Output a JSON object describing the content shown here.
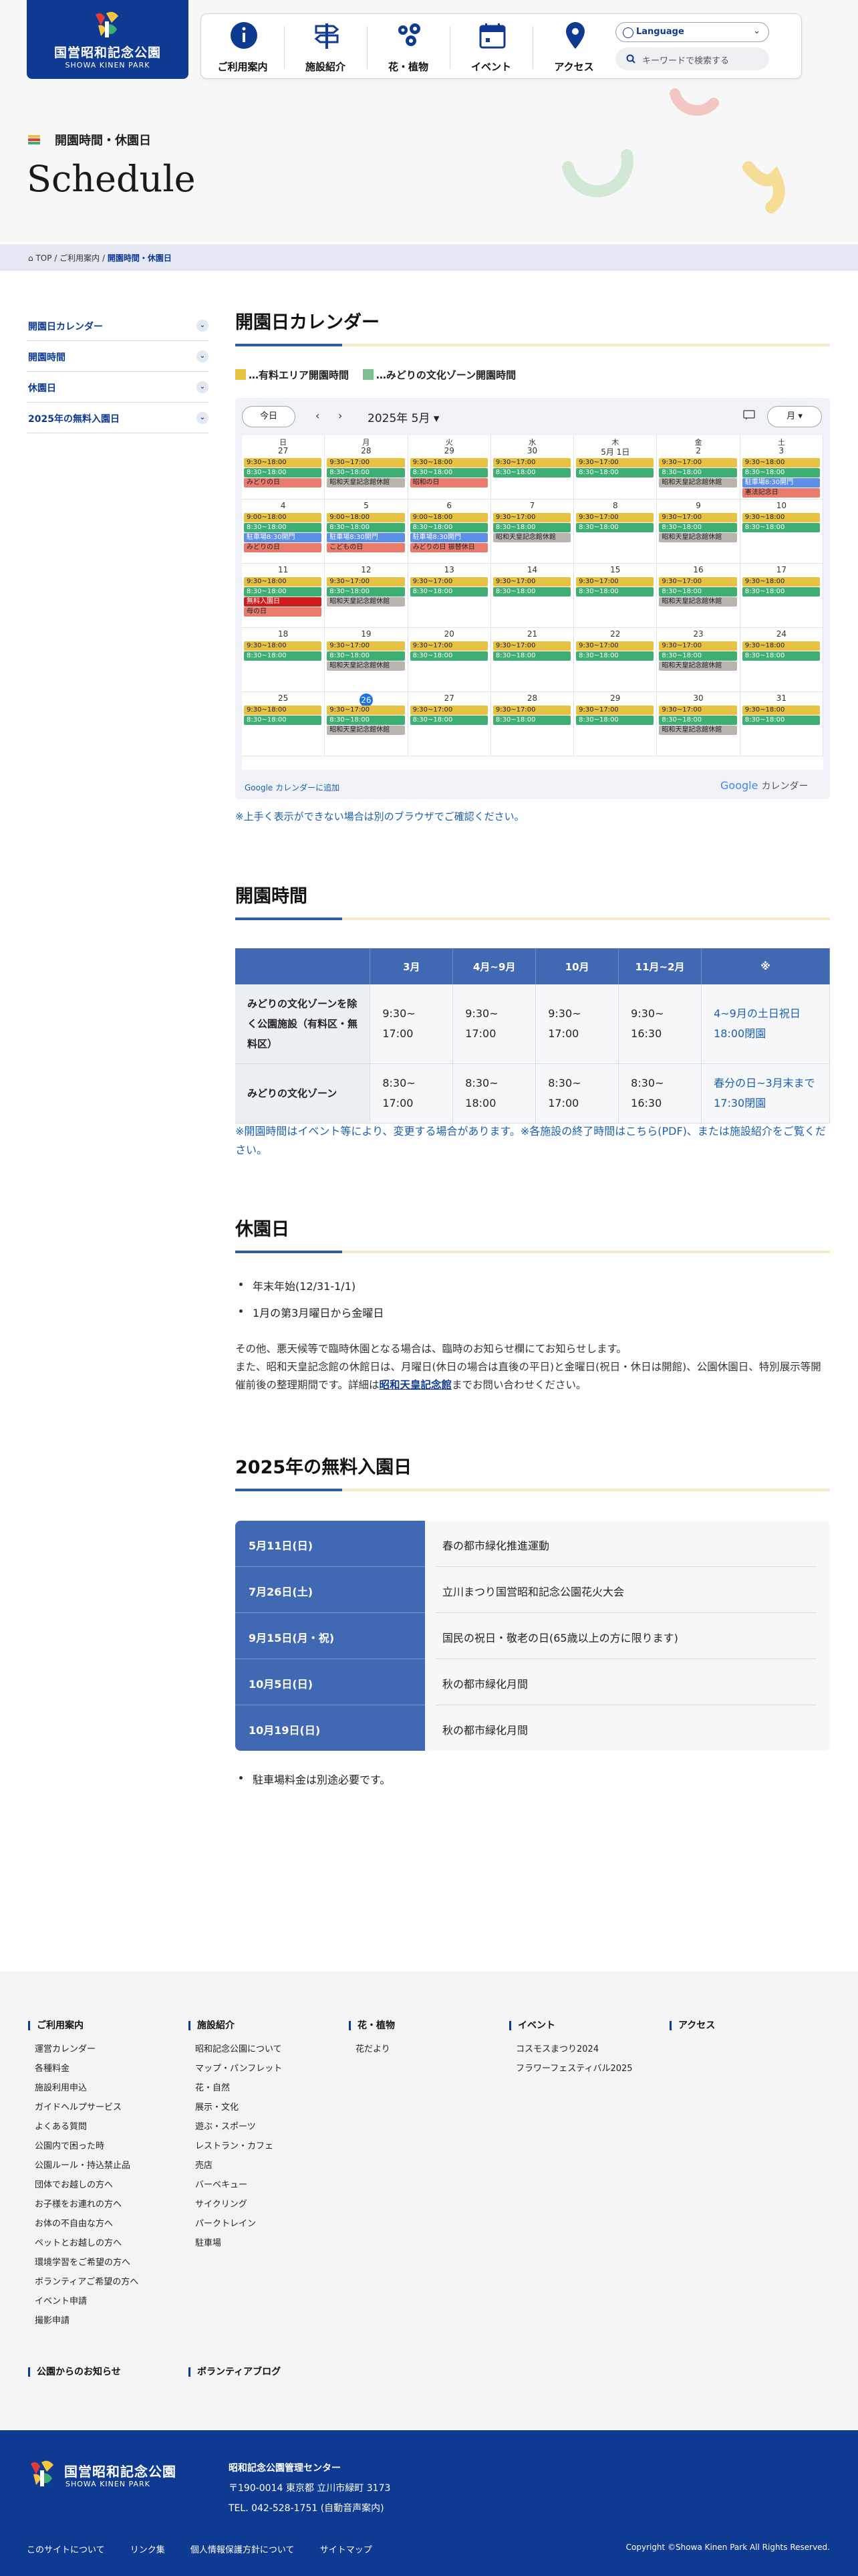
{
  "site": {
    "logo_ja": "国営昭和記念公園",
    "logo_en": "SHOWA KINEN PARK"
  },
  "gnav": [
    {
      "label": "ご利用案内",
      "icon": "info-icon"
    },
    {
      "label": "施設紹介",
      "icon": "signpost-icon"
    },
    {
      "label": "花・植物",
      "icon": "flower-icon"
    },
    {
      "label": "イベント",
      "icon": "calendar-icon"
    },
    {
      "label": "アクセス",
      "icon": "map-pin-icon"
    }
  ],
  "language": {
    "label": "Language"
  },
  "search": {
    "placeholder": "キーワードで検索する"
  },
  "page": {
    "subtitle": "開園時間・休園日",
    "title": "Schedule"
  },
  "breadcrumb": {
    "top": "TOP",
    "sep1": "/",
    "guide": "ご利用案内",
    "sep2": "/",
    "current": "開園時間・休園日"
  },
  "sidebar": [
    {
      "label": "開園日カレンダー"
    },
    {
      "label": "開園時間"
    },
    {
      "label": "休園日"
    },
    {
      "label": "2025年の無料入園日"
    }
  ],
  "sections": {
    "calendar": "開園日カレンダー",
    "hours": "開園時間",
    "closed": "休園日",
    "free": "2025年の無料入園日"
  },
  "legend": {
    "yellow": "…有料エリア開園時間",
    "green": "…みどりの文化ゾーン開園時間",
    "yellow_color": "#e8c343",
    "green_color": "#3fae72"
  },
  "calendar": {
    "today_btn": "今日",
    "prev": "‹",
    "next": "›",
    "month": "2025年 5月",
    "month_caret": "▾",
    "view": "月",
    "view_caret": "▾",
    "weekdays": [
      "日",
      "月",
      "火",
      "水",
      "木",
      "金",
      "土"
    ],
    "weeks": [
      {
        "days": [
          "27",
          "28",
          "29",
          "30",
          "5月 1日",
          "2",
          "3"
        ],
        "events": [
          [
            "9:30~18:00",
            "8:30~18:00",
            "みどりの日"
          ],
          [
            "9:30~17:00",
            "8:30~18:00",
            "昭和天皇記念館休館"
          ],
          [
            "9:30~18:00",
            "8:30~18:00",
            "昭和の日"
          ],
          [
            "9:30~17:00",
            "8:30~18:00"
          ],
          [
            "9:30~17:00",
            "8:30~18:00"
          ],
          [
            "9:30~17:00",
            "8:30~18:00",
            "昭和天皇記念館休館"
          ],
          [
            "9:30~18:00",
            "8:30~18:00",
            "駐車場8:30開門",
            "憲法記念日"
          ]
        ]
      },
      {
        "days": [
          "4",
          "5",
          "6",
          "7",
          "8",
          "9",
          "10"
        ],
        "events": [
          [
            "9:00~18:00",
            "8:30~18:00",
            "駐車場8:30開門",
            "みどりの日"
          ],
          [
            "9:00~18:00",
            "8:30~18:00",
            "駐車場8:30開門",
            "こどもの日"
          ],
          [
            "9:00~18:00",
            "8:30~18:00",
            "駐車場8:30開門",
            "みどりの日 振替休日"
          ],
          [
            "9:30~17:00",
            "8:30~18:00",
            "昭和天皇記念館休館"
          ],
          [
            "9:30~17:00",
            "8:30~18:00"
          ],
          [
            "9:30~17:00",
            "8:30~18:00",
            "昭和天皇記念館休館"
          ],
          [
            "9:30~18:00",
            "8:30~18:00"
          ]
        ]
      },
      {
        "days": [
          "11",
          "12",
          "13",
          "14",
          "15",
          "16",
          "17"
        ],
        "events": [
          [
            "9:30~18:00",
            "8:30~18:00",
            "無料入園日",
            "母の日"
          ],
          [
            "9:30~17:00",
            "8:30~18:00",
            "昭和天皇記念館休館"
          ],
          [
            "9:30~17:00",
            "8:30~18:00"
          ],
          [
            "9:30~17:00",
            "8:30~18:00"
          ],
          [
            "9:30~17:00",
            "8:30~18:00"
          ],
          [
            "9:30~17:00",
            "8:30~18:00",
            "昭和天皇記念館休館"
          ],
          [
            "9:30~18:00",
            "8:30~18:00"
          ]
        ]
      },
      {
        "days": [
          "18",
          "19",
          "20",
          "21",
          "22",
          "23",
          "24"
        ],
        "events": [
          [
            "9:30~18:00",
            "8:30~18:00"
          ],
          [
            "9:30~17:00",
            "8:30~18:00",
            "昭和天皇記念館休館"
          ],
          [
            "9:30~17:00",
            "8:30~18:00"
          ],
          [
            "9:30~17:00",
            "8:30~18:00"
          ],
          [
            "9:30~17:00",
            "8:30~18:00"
          ],
          [
            "9:30~17:00",
            "8:30~18:00",
            "昭和天皇記念館休館"
          ],
          [
            "9:30~18:00",
            "8:30~18:00"
          ]
        ]
      },
      {
        "days": [
          "25",
          "26",
          "27",
          "28",
          "29",
          "30",
          "31"
        ],
        "events": [
          [
            "9:30~18:00",
            "8:30~18:00"
          ],
          [
            "9:30~17:00",
            "8:30~18:00",
            "昭和天皇記念館休館"
          ],
          [
            "9:30~17:00",
            "8:30~18:00"
          ],
          [
            "9:30~17:00",
            "8:30~18:00"
          ],
          [
            "9:30~17:00",
            "8:30~18:00"
          ],
          [
            "9:30~17:00",
            "8:30~18:00",
            "昭和天皇記念館休館"
          ],
          [
            "9:30~18:00",
            "8:30~18:00"
          ]
        ]
      }
    ],
    "today_index": [
      4,
      1
    ],
    "add_link": "Google カレンダーに追加",
    "brand_google": "Google",
    "brand_cal": "カレンダー"
  },
  "calendar_note": "※上手く表示ができない場合は別のブラウザでご確認ください。",
  "hours_table": {
    "headers": [
      "",
      "3月",
      "4月~9月",
      "10月",
      "11月~2月",
      "※"
    ],
    "rows": [
      {
        "label": "みどりの文化ゾーンを除く公園施設（有料区・無料区）",
        "cells": [
          "9:30~ 17:00",
          "9:30~ 17:00",
          "9:30~ 17:00",
          "9:30~ 16:30",
          "4~9月の土日祝日 18:00閉園"
        ]
      },
      {
        "label": "みどりの文化ゾーン",
        "cells": [
          "8:30~ 17:00",
          "8:30~ 18:00",
          "8:30~ 17:00",
          "8:30~ 16:30",
          "春分の日~3月末まで17:30閉園"
        ]
      }
    ]
  },
  "hours_note": "※開園時間はイベント等により、変更する場合があります。※各施設の終了時間はこちら(PDF)、または施設紹介をご覧ください。",
  "closed": {
    "items": [
      "年末年始(12/31-1/1)",
      "1月の第3月曜日から金曜日"
    ],
    "para1": "その他、悪天候等で臨時休園となる場合は、臨時のお知らせ欄にてお知らせします。",
    "para2a": "また、昭和天皇記念館の休館日は、月曜日(休日の場合は直後の平日)と金曜日(祝日・休日は開館)、公園休園日、特別展示等開催前後の整理期間です。詳細は",
    "para2link": "昭和天皇記念館",
    "para2b": "までお問い合わせください。"
  },
  "free_days": [
    {
      "date": "5月11日(日)",
      "event": "春の都市緑化推進運動"
    },
    {
      "date": "7月26日(土)",
      "event": "立川まつり国営昭和記念公園花火大会"
    },
    {
      "date": "9月15日(月・祝)",
      "event": "国民の祝日・敬老の日(65歳以上の方に限ります)"
    },
    {
      "date": "10月5日(日)",
      "event": "秋の都市緑化月間"
    },
    {
      "date": "10月19日(日)",
      "event": "秋の都市緑化月間"
    }
  ],
  "free_note": "駐車場料金は別途必要です。",
  "footer_nav": [
    {
      "title": "ご利用案内",
      "items": [
        "運営カレンダー",
        "各種料金",
        "施設利用申込",
        "ガイドヘルプサービス",
        "よくある質問",
        "公園内で困った時",
        "公園ルール・持込禁止品",
        "団体でお越しの方へ",
        "お子様をお連れの方へ",
        "お体の不自由な方へ",
        "ペットとお越しの方へ",
        "環境学習をご希望の方へ",
        "ボランティアご希望の方へ",
        "イベント申請",
        "撮影申請"
      ]
    },
    {
      "title": "施設紹介",
      "items": [
        "昭和記念公園について",
        "マップ・パンフレット",
        "花・自然",
        "展示・文化",
        "遊ぶ・スポーツ",
        "レストラン・カフェ",
        "売店",
        "バーベキュー",
        "サイクリング",
        "パークトレイン",
        "駐車場"
      ]
    },
    {
      "title": "花・植物",
      "items": [
        "花だより"
      ]
    },
    {
      "title": "イベント",
      "items": [
        "コスモスまつり2024",
        "フラワーフェスティバル2025"
      ]
    },
    {
      "title": "アクセス",
      "items": []
    }
  ],
  "footer_extra": [
    "公園からのお知らせ",
    "ボランティアブログ"
  ],
  "footer": {
    "org": "昭和記念公園管理センター",
    "address": "〒190-0014 東京都 立川市緑町 3173",
    "tel": "TEL. 042-528-1751 (自動音声案内)",
    "links": [
      "このサイトについて",
      "リンク集",
      "個人情報保護方針について",
      "サイトマップ"
    ],
    "copyright": "Copyright ©Showa Kinen Park All Rights Reserved."
  }
}
